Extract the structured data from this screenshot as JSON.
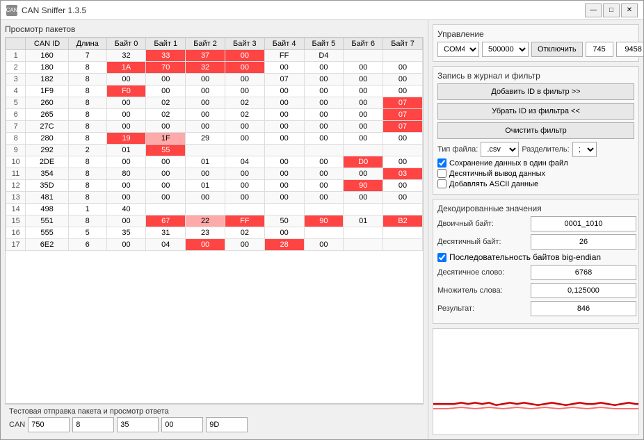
{
  "window": {
    "title": "CAN Sniffer 1.3.5",
    "icon_label": "CAN"
  },
  "titlebar": {
    "minimize": "—",
    "maximize": "□",
    "close": "✕"
  },
  "left_panel": {
    "title": "Просмотр пакетов",
    "columns": [
      "",
      "CAN ID",
      "Длина",
      "Байт 0",
      "Байт 1",
      "Байт 2",
      "Байт 3",
      "Байт 4",
      "Байт 5",
      "Байт 6",
      "Байт 7"
    ],
    "rows": [
      {
        "num": "1",
        "id": "160",
        "len": "7",
        "b0": "32",
        "b1": "33",
        "b2": "37",
        "b3": "00",
        "b4": "FF",
        "b5": "D4",
        "b6": "",
        "b7": "",
        "b0c": "normal",
        "b1c": "red",
        "b2c": "red",
        "b3c": "red",
        "b4c": "normal",
        "b5c": "normal"
      },
      {
        "num": "2",
        "id": "180",
        "len": "8",
        "b0": "1A",
        "b1": "70",
        "b2": "32",
        "b3": "00",
        "b4": "00",
        "b5": "00",
        "b6": "00",
        "b7": "00",
        "b0c": "red",
        "b1c": "red",
        "b2c": "red",
        "b3c": "red"
      },
      {
        "num": "3",
        "id": "182",
        "len": "8",
        "b0": "00",
        "b1": "00",
        "b2": "00",
        "b3": "00",
        "b4": "07",
        "b5": "00",
        "b6": "00",
        "b7": "00",
        "b0c": "normal"
      },
      {
        "num": "4",
        "id": "1F9",
        "len": "8",
        "b0": "F0",
        "b1": "00",
        "b2": "00",
        "b3": "00",
        "b4": "00",
        "b5": "00",
        "b6": "00",
        "b7": "00",
        "b0c": "red"
      },
      {
        "num": "5",
        "id": "260",
        "len": "8",
        "b0": "00",
        "b1": "02",
        "b2": "00",
        "b3": "02",
        "b4": "00",
        "b5": "00",
        "b6": "00",
        "b7": "07",
        "b7c": "red"
      },
      {
        "num": "6",
        "id": "265",
        "len": "8",
        "b0": "00",
        "b1": "02",
        "b2": "00",
        "b3": "02",
        "b4": "00",
        "b5": "00",
        "b6": "00",
        "b7": "07",
        "b7c": "red"
      },
      {
        "num": "7",
        "id": "27C",
        "len": "8",
        "b0": "00",
        "b1": "00",
        "b2": "00",
        "b3": "00",
        "b4": "00",
        "b5": "00",
        "b6": "00",
        "b7": "07",
        "b7c": "red"
      },
      {
        "num": "8",
        "id": "280",
        "len": "8",
        "b0": "19",
        "b1": "1F",
        "b2": "29",
        "b3": "00",
        "b4": "00",
        "b5": "00",
        "b6": "00",
        "b7": "00",
        "b0c": "red",
        "b1c": "pink"
      },
      {
        "num": "9",
        "id": "292",
        "len": "2",
        "b0": "01",
        "b1": "55",
        "b2": "",
        "b3": "",
        "b4": "",
        "b5": "",
        "b6": "",
        "b7": "",
        "b1c": "red"
      },
      {
        "num": "10",
        "id": "2DE",
        "len": "8",
        "b0": "00",
        "b1": "00",
        "b2": "01",
        "b3": "04",
        "b4": "00",
        "b5": "00",
        "b6": "D0",
        "b7": "00",
        "b6c": "red"
      },
      {
        "num": "11",
        "id": "354",
        "len": "8",
        "b0": "80",
        "b1": "00",
        "b2": "00",
        "b3": "00",
        "b4": "00",
        "b5": "00",
        "b6": "00",
        "b7": "03",
        "b7c": "red"
      },
      {
        "num": "12",
        "id": "35D",
        "len": "8",
        "b0": "00",
        "b1": "00",
        "b2": "01",
        "b3": "00",
        "b4": "00",
        "b5": "00",
        "b6": "90",
        "b7": "00",
        "b6c": "red"
      },
      {
        "num": "13",
        "id": "481",
        "len": "8",
        "b0": "00",
        "b1": "00",
        "b2": "00",
        "b3": "00",
        "b4": "00",
        "b5": "00",
        "b6": "00",
        "b7": "00"
      },
      {
        "num": "14",
        "id": "498",
        "len": "1",
        "b0": "40",
        "b1": "",
        "b2": "",
        "b3": "",
        "b4": "",
        "b5": "",
        "b6": "",
        "b7": ""
      },
      {
        "num": "15",
        "id": "551",
        "len": "8",
        "b0": "00",
        "b1": "67",
        "b2": "22",
        "b3": "FF",
        "b4": "50",
        "b5": "90",
        "b6": "01",
        "b7": "B2",
        "b1c": "red",
        "b2c": "pink",
        "b3c": "red",
        "b5c": "red",
        "b7c": "red"
      },
      {
        "num": "16",
        "id": "555",
        "len": "5",
        "b0": "35",
        "b1": "31",
        "b2": "23",
        "b3": "02",
        "b4": "00",
        "b5": "",
        "b6": "",
        "b7": ""
      },
      {
        "num": "17",
        "id": "6E2",
        "len": "6",
        "b0": "00",
        "b1": "04",
        "b2": "00",
        "b3": "00",
        "b4": "28",
        "b5": "00",
        "b6": "",
        "b7": "",
        "b2c": "red",
        "b4c": "red"
      }
    ]
  },
  "bottom_panel": {
    "title": "Тестовая отправка пакета и просмотр ответа",
    "label": "CAN",
    "input1": "750",
    "input2": "8",
    "input3": "35",
    "input4": "00",
    "input5": "9D"
  },
  "right_panel": {
    "control_title": "Управление",
    "com_port": "COM4",
    "baudrate": "500000",
    "disconnect_btn": "Отключить",
    "val1": "745",
    "val2": "9458",
    "record_title": "Запись в журнал и фильтр",
    "add_id_btn": "Добавить ID в фильтр >>",
    "remove_id_btn": "Убрать ID из фильтра <<",
    "clear_filter_btn": "Очистить фильтр",
    "file_type_label": "Тип файла:",
    "file_type": ".csv",
    "delimiter_label": "Разделитель:",
    "delimiter": ";",
    "save_one_file": "Сохранение данных в один файл",
    "decimal_output": "Десятичный вывод данных",
    "add_ascii": "Добавлять ASCII данные",
    "decode_title": "Декодированные значения",
    "binary_label": "Двоичный байт:",
    "binary_value": "0001_1010",
    "decimal_label": "Десятичный байт:",
    "decimal_value": "26",
    "big_endian_label": "Последовательность байтов big-endian",
    "decimal_word_label": "Десятичное слово:",
    "decimal_word_value": "6768",
    "multiplier_label": "Множитель слова:",
    "multiplier_value": "0,125000",
    "result_label": "Результат:",
    "result_value": "846"
  }
}
